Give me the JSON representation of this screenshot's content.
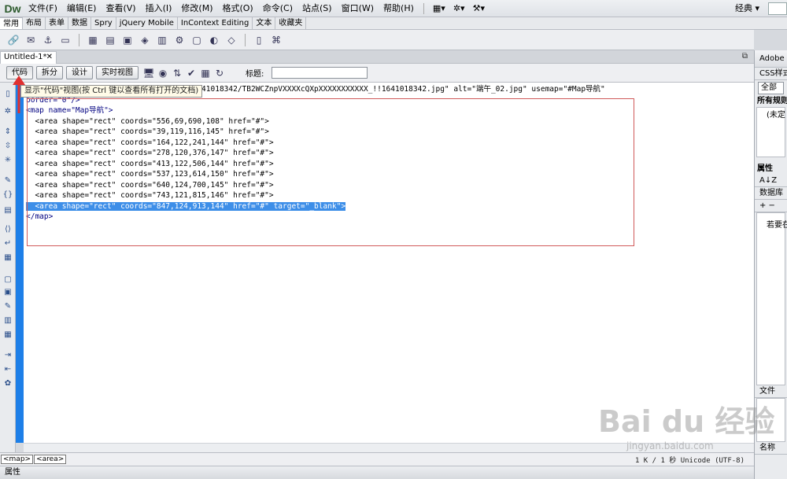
{
  "app": {
    "logo": "Dw",
    "workspace": "经典 ▾"
  },
  "menubar": {
    "items": [
      "文件(F)",
      "编辑(E)",
      "查看(V)",
      "插入(I)",
      "修改(M)",
      "格式(O)",
      "命令(C)",
      "站点(S)",
      "窗口(W)",
      "帮助(H)"
    ],
    "layout_btn": "▦▾",
    "extend_btn": "✲▾",
    "site_btn": "⚒▾"
  },
  "insert_tabs": [
    "常用",
    "布局",
    "表单",
    "数据",
    "Spry",
    "jQuery Mobile",
    "InContext Editing",
    "文本",
    "收藏夹"
  ],
  "document": {
    "tab_title": "Untitled-1*",
    "close": "✕"
  },
  "viewbar": {
    "code": "代码",
    "split": "拆分",
    "design": "设计",
    "live": "实时视图",
    "title_label": "标题:",
    "title_value": ""
  },
  "tooltip": "显示\"代码\"视图(按 Ctrl 键以查看所有打开的文档)",
  "code": {
    "line0": "                            extra/12/1641018342/TB2WCZnpVXXXXcQXpXXXXXXXXXXX_!!1641018342.jpg\" alt=\"端午_02.jpg\" usemap=\"#Map导航\"",
    "line1": "border=\"0\"/>",
    "map_open": "<map name=\"Map导航\">",
    "areas": [
      "  <area shape=\"rect\" coords=\"556,69,690,108\" href=\"#\">",
      "  <area shape=\"rect\" coords=\"39,119,116,145\" href=\"#\">",
      "  <area shape=\"rect\" coords=\"164,122,241,144\" href=\"#\">",
      "  <area shape=\"rect\" coords=\"278,120,376,147\" href=\"#\">",
      "  <area shape=\"rect\" coords=\"413,122,506,144\" href=\"#\">",
      "  <area shape=\"rect\" coords=\"537,123,614,150\" href=\"#\">",
      "  <area shape=\"rect\" coords=\"640,124,700,145\" href=\"#\">",
      "  <area shape=\"rect\" coords=\"743,121,815,146\" href=\"#\">"
    ],
    "selected": "  <area shape=\"rect\" coords=\"847,124,913,144\" href=\"#\" target=\"_blank\">",
    "map_close": "</map>"
  },
  "tag_selector": [
    "<map>",
    "<area>"
  ],
  "status": "1 K / 1 秒  Unicode (UTF-8)",
  "properties_label": "属性",
  "right_panel": {
    "adobe": "Adobe",
    "css": "CSS样式",
    "all": "全部",
    "rules": "所有规则",
    "undefined": "(未定",
    "props": "属性",
    "az": "A↓Z",
    "database": "数据库",
    "plusminus": "+ −",
    "hint": "若要在",
    "files": "文件",
    "name": "名称"
  },
  "watermark": {
    "brand": "Bai du 经验",
    "url": "jingyan.baidu.com"
  }
}
